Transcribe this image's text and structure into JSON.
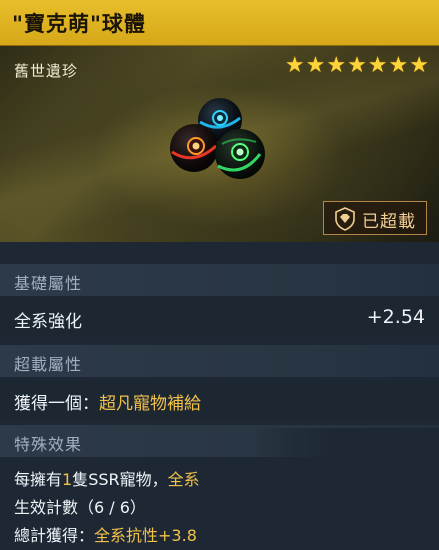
{
  "item": {
    "name": "\"寶克萌\"球體",
    "rarity": "舊世遺珍",
    "star_count": 7,
    "star_glyph": "★",
    "overload_label": "已超載"
  },
  "sections": {
    "base": {
      "header": "基礎屬性",
      "stat_label": "全系強化",
      "stat_value": "+2.54"
    },
    "overload": {
      "header": "超載屬性",
      "gain_prefix": "獲得一個：",
      "gain_value": "超凡寵物補給"
    },
    "special": {
      "header": "特殊效果",
      "line1_a": "每擁有",
      "line1_b": "1",
      "line1_c": "隻SSR寵物，",
      "line1_d": "全系",
      "line2": "生效計數（6 / 6）",
      "line3_a": "總計獲得：",
      "line3_b": "全系抗性+3.8"
    }
  },
  "colors": {
    "title_bar": "#e7be2b",
    "gold_text": "#f2c14a",
    "star": "#ffd43a",
    "panel": "#1e2834"
  }
}
